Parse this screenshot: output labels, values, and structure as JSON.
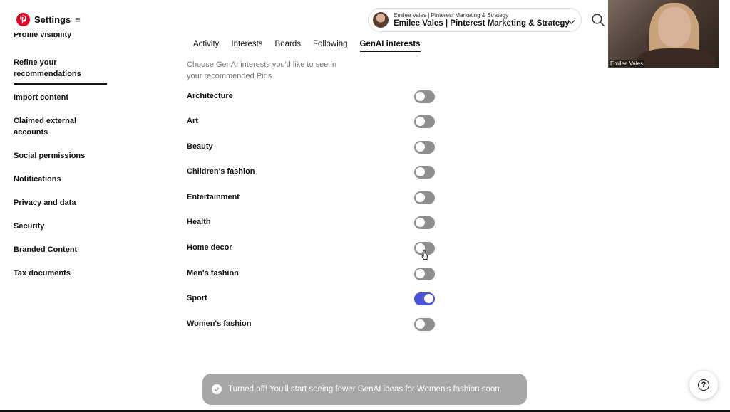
{
  "header": {
    "title": "Settings",
    "menu_icon": "≡",
    "account": {
      "small": "Emilee Vales | Pinterest Marketing & Strategy",
      "name": "Emilee Vales | Pinterest Marketing & Strategy"
    }
  },
  "webcam": {
    "label": "Emilee Vales"
  },
  "sidebar": {
    "items": [
      {
        "label": "Profile visibility"
      },
      {
        "label": "Refine your recommendations",
        "active": true
      },
      {
        "label": "Import content"
      },
      {
        "label": "Claimed external accounts"
      },
      {
        "label": "Social permissions"
      },
      {
        "label": "Notifications"
      },
      {
        "label": "Privacy and data"
      },
      {
        "label": "Security"
      },
      {
        "label": "Branded Content"
      },
      {
        "label": "Tax documents"
      }
    ]
  },
  "tabs": [
    {
      "label": "Activity"
    },
    {
      "label": "Interests"
    },
    {
      "label": "Boards"
    },
    {
      "label": "Following"
    },
    {
      "label": "GenAI interests",
      "active": true
    }
  ],
  "description": "Choose GenAI interests you'd like to see in your recommended Pins.",
  "interests": [
    {
      "label": "Architecture",
      "on": false
    },
    {
      "label": "Art",
      "on": false
    },
    {
      "label": "Beauty",
      "on": false
    },
    {
      "label": "Children's fashion",
      "on": false
    },
    {
      "label": "Entertainment",
      "on": false
    },
    {
      "label": "Health",
      "on": false
    },
    {
      "label": "Home decor",
      "on": false
    },
    {
      "label": "Men's fashion",
      "on": false
    },
    {
      "label": "Sport",
      "on": true
    },
    {
      "label": "Women's fashion",
      "on": false
    }
  ],
  "toast": {
    "text": "Turned off! You'll start seeing fewer GenAI ideas for Women's fashion soon."
  },
  "help": {
    "label": "?"
  },
  "colors": {
    "toggle_on": "#4a52d6",
    "toggle_off": "#8e8e8e",
    "brand": "#e60023"
  }
}
